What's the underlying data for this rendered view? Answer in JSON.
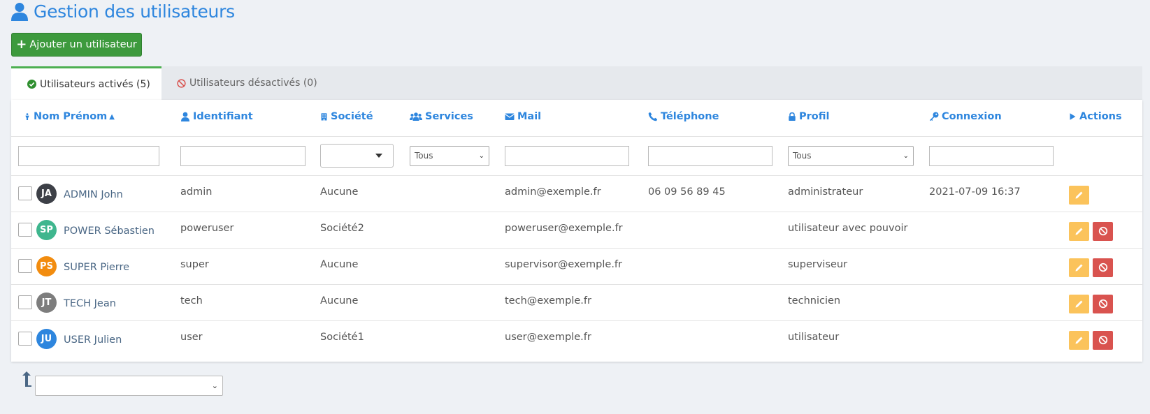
{
  "page": {
    "title": "Gestion des utilisateurs",
    "title_icon": "user-icon",
    "accent_color": "#2e86de"
  },
  "toolbar": {
    "add_label": "Ajouter un utilisateur",
    "add_color": "#3d9a3d"
  },
  "tabs": [
    {
      "label": "Utilisateurs activés (5)",
      "icon": "check-circle-icon",
      "active": true
    },
    {
      "label": "Utilisateurs désactivés (0)",
      "icon": "ban-icon",
      "active": false
    }
  ],
  "columns": {
    "name": "Nom Prénom",
    "ident": "Identifiant",
    "societe": "Société",
    "services": "Services",
    "mail": "Mail",
    "telephone": "Téléphone",
    "profil": "Profil",
    "connexion": "Connexion",
    "actions": "Actions"
  },
  "filters": {
    "services_value": "Tous",
    "profil_value": "Tous"
  },
  "rows": [
    {
      "initials": "JA",
      "avatar_color": "#3d4047",
      "name": "ADMIN John",
      "ident": "admin",
      "societe": "Aucune",
      "services": "",
      "mail": "admin@exemple.fr",
      "telephone": "06 09 56 89 45",
      "profil": "administrateur",
      "connexion": "2021-07-09 16:37",
      "can_ban": false
    },
    {
      "initials": "SP",
      "avatar_color": "#3fb68e",
      "name": "POWER Sébastien",
      "ident": "poweruser",
      "societe": "Société2",
      "services": "",
      "mail": "poweruser@exemple.fr",
      "telephone": "",
      "profil": "utilisateur avec pouvoir",
      "connexion": "",
      "can_ban": true
    },
    {
      "initials": "PS",
      "avatar_color": "#f28c0f",
      "name": "SUPER Pierre",
      "ident": "super",
      "societe": "Aucune",
      "services": "",
      "mail": "supervisor@exemple.fr",
      "telephone": "",
      "profil": "superviseur",
      "connexion": "",
      "can_ban": true
    },
    {
      "initials": "JT",
      "avatar_color": "#7d7d7d",
      "name": "TECH Jean",
      "ident": "tech",
      "societe": "Aucune",
      "services": "",
      "mail": "tech@exemple.fr",
      "telephone": "",
      "profil": "technicien",
      "connexion": "",
      "can_ban": true
    },
    {
      "initials": "JU",
      "avatar_color": "#2e86de",
      "name": "USER Julien",
      "ident": "user",
      "societe": "Société1",
      "services": "",
      "mail": "user@exemple.fr",
      "telephone": "",
      "profil": "utilisateur",
      "connexion": "",
      "can_ban": true
    }
  ],
  "colors": {
    "edit_button": "#fbc35b",
    "ban_button": "#d9534f",
    "active_tab_border": "#4caf50"
  }
}
